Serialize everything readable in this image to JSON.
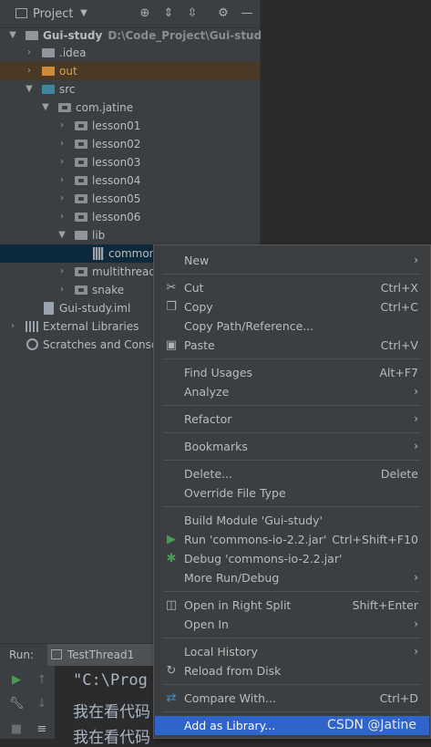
{
  "project_panel": {
    "title": "Project",
    "dropdown_icon": "chevron-down-icon",
    "toolbar_icons": [
      "target-icon",
      "expand-all-icon",
      "collapse-all-icon",
      "gear-icon",
      "minimize-icon"
    ]
  },
  "tree": {
    "root_name": "Gui-study",
    "root_path": "D:\\Code_Project\\Gui-study",
    "idea": ".idea",
    "out": "out",
    "src": "src",
    "package": "com.jatine",
    "lessons": [
      "lesson01",
      "lesson02",
      "lesson03",
      "lesson04",
      "lesson05",
      "lesson06"
    ],
    "lib": "lib",
    "lib_file": "common",
    "multithread": "multithread",
    "snake": "snake",
    "iml": "Gui-study.iml",
    "external": "External Libraries",
    "scratches": "Scratches and Conso"
  },
  "run": {
    "label": "Run:",
    "tab": "TestThread1",
    "console_lines": [
      "\"C:\\Prog",
      "我在看代码",
      "我在看代码"
    ]
  },
  "menu": {
    "new": {
      "label": "New",
      "shortcut": ""
    },
    "cut": {
      "label": "Cut",
      "shortcut": "Ctrl+X"
    },
    "copy": {
      "label": "Copy",
      "shortcut": "Ctrl+C"
    },
    "copy_path": {
      "label": "Copy Path/Reference...",
      "shortcut": ""
    },
    "paste": {
      "label": "Paste",
      "shortcut": "Ctrl+V"
    },
    "find_usages": {
      "label": "Find Usages",
      "shortcut": "Alt+F7"
    },
    "analyze": {
      "label": "Analyze",
      "shortcut": ""
    },
    "refactor": {
      "label": "Refactor",
      "shortcut": ""
    },
    "bookmarks": {
      "label": "Bookmarks",
      "shortcut": ""
    },
    "delete": {
      "label": "Delete...",
      "shortcut": "Delete"
    },
    "override": {
      "label": "Override File Type",
      "shortcut": ""
    },
    "build": {
      "label": "Build Module 'Gui-study'",
      "shortcut": ""
    },
    "run": {
      "label": "Run 'commons-io-2.2.jar'",
      "shortcut": "Ctrl+Shift+F10"
    },
    "debug": {
      "label": "Debug 'commons-io-2.2.jar'",
      "shortcut": ""
    },
    "more_run": {
      "label": "More Run/Debug",
      "shortcut": ""
    },
    "open_right": {
      "label": "Open in Right Split",
      "shortcut": "Shift+Enter"
    },
    "open_in": {
      "label": "Open In",
      "shortcut": ""
    },
    "local_history": {
      "label": "Local History",
      "shortcut": ""
    },
    "reload": {
      "label": "Reload from Disk",
      "shortcut": ""
    },
    "compare": {
      "label": "Compare With...",
      "shortcut": "Ctrl+D"
    },
    "add_library": {
      "label": "Add as Library...",
      "shortcut": ""
    }
  },
  "watermark": "CSDN @Jatine",
  "colors": {
    "accent": "#2f65ca",
    "run_green": "#499c54",
    "debug_green": "#499c54"
  }
}
